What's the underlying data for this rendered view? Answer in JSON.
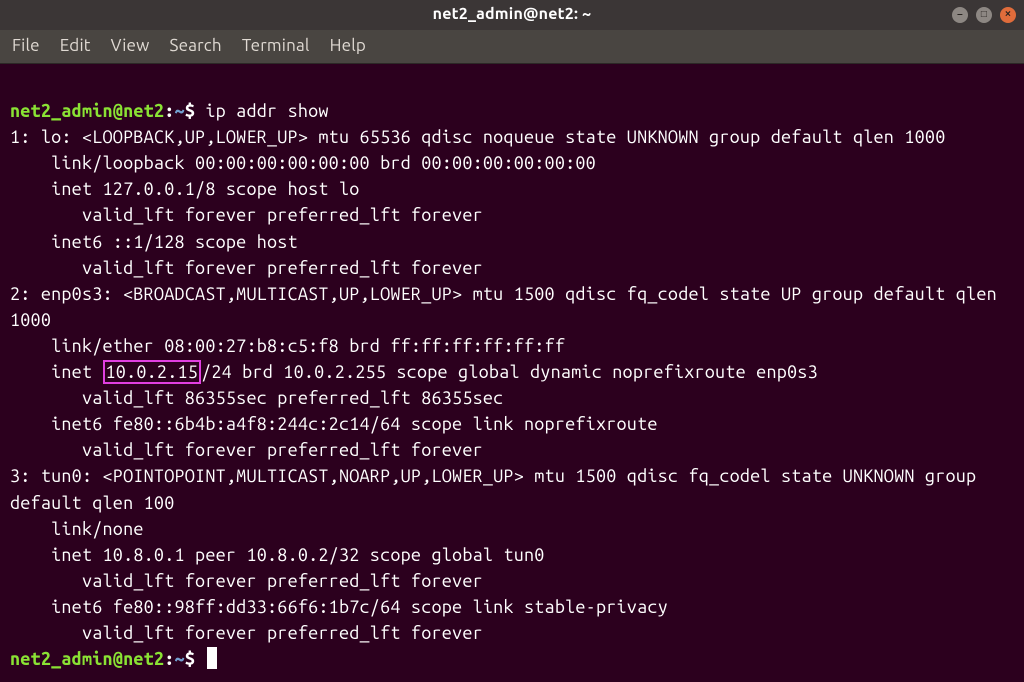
{
  "window": {
    "title": "net2_admin@net2: ~"
  },
  "menubar": {
    "items": [
      "File",
      "Edit",
      "View",
      "Search",
      "Terminal",
      "Help"
    ]
  },
  "prompt": {
    "user": "net2_admin",
    "host": "net2",
    "path": "~",
    "sep_at": "@",
    "sep_colon": ":",
    "dollar": "$"
  },
  "command": "ip addr show",
  "highlight_ip": "10.0.2.15",
  "lines": {
    "l1": "1: lo: <LOOPBACK,UP,LOWER_UP> mtu 65536 qdisc noqueue state UNKNOWN group default qlen 1000",
    "l2": "    link/loopback 00:00:00:00:00:00 brd 00:00:00:00:00:00",
    "l3": "    inet 127.0.0.1/8 scope host lo",
    "l4": "       valid_lft forever preferred_lft forever",
    "l5": "    inet6 ::1/128 scope host",
    "l6": "       valid_lft forever preferred_lft forever",
    "l7": "2: enp0s3: <BROADCAST,MULTICAST,UP,LOWER_UP> mtu 1500 qdisc fq_codel state UP group default qlen 1000",
    "l8": "    link/ether 08:00:27:b8:c5:f8 brd ff:ff:ff:ff:ff:ff",
    "l9a": "    inet ",
    "l9b": "/24 brd 10.0.2.255 scope global dynamic noprefixroute enp0s3",
    "l10": "       valid_lft 86355sec preferred_lft 86355sec",
    "l11": "    inet6 fe80::6b4b:a4f8:244c:2c14/64 scope link noprefixroute",
    "l12": "       valid_lft forever preferred_lft forever",
    "l13": "3: tun0: <POINTOPOINT,MULTICAST,NOARP,UP,LOWER_UP> mtu 1500 qdisc fq_codel state UNKNOWN group default qlen 100",
    "l14": "    link/none",
    "l15": "    inet 10.8.0.1 peer 10.8.0.2/32 scope global tun0",
    "l16": "       valid_lft forever preferred_lft forever",
    "l17": "    inet6 fe80::98ff:dd33:66f6:1b7c/64 scope link stable-privacy",
    "l18": "       valid_lft forever preferred_lft forever"
  }
}
